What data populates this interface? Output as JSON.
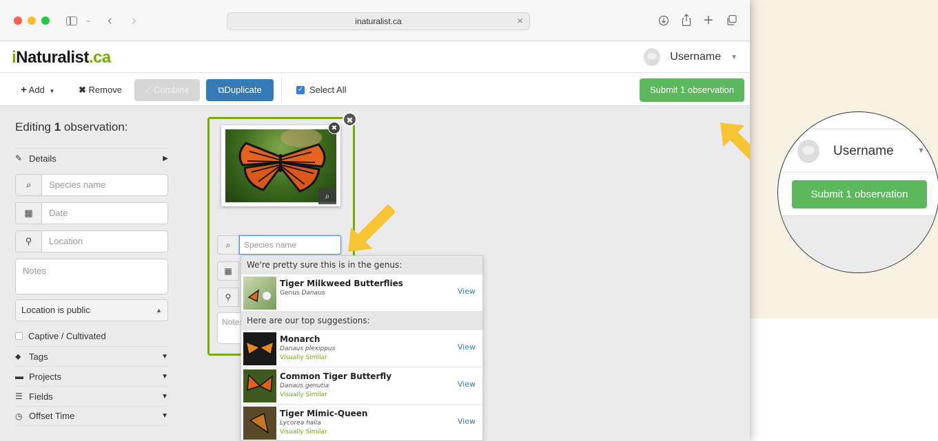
{
  "browser": {
    "url": "inaturalist.ca"
  },
  "header": {
    "logo_i": "i",
    "logo_main": "Naturalist",
    "logo_ca": ".ca",
    "username": "Username"
  },
  "toolbar": {
    "add_label": "Add",
    "remove_label": "Remove",
    "combine_label": "Combine",
    "duplicate_label": "Duplicate",
    "select_all_label": "Select All",
    "submit_label": "Submit 1 observation"
  },
  "left_panel": {
    "editing_prefix": "Editing ",
    "editing_count": "1",
    "editing_suffix": " observation:",
    "details_label": "Details",
    "species_placeholder": "Species name",
    "date_placeholder": "Date",
    "location_placeholder": "Location",
    "notes_placeholder": "Notes",
    "location_privacy": "Location is public",
    "captive_label": "Captive / Cultivated",
    "tags_label": "Tags",
    "projects_label": "Projects",
    "fields_label": "Fields",
    "offset_time_label": "Offset Time"
  },
  "card": {
    "species_placeholder": "Species name",
    "notes_placeholder": "Notes"
  },
  "autocomplete": {
    "genus_header": "We're pretty sure this is in the genus:",
    "top_header": "Here are our top suggestions:",
    "view_label": "View",
    "genus_item": {
      "title": "Tiger Milkweed Butterflies",
      "rank": "Genus",
      "scientific": "Danaus"
    },
    "suggestions": [
      {
        "title": "Monarch",
        "scientific": "Danaus plexippus",
        "tag": "Visually Similar"
      },
      {
        "title": "Common Tiger Butterfly",
        "scientific": "Danaus genutia",
        "tag": "Visually Similar"
      },
      {
        "title": "Tiger Mimic-Queen",
        "scientific": "Lycorea halia",
        "tag": "Visually Similar"
      }
    ]
  },
  "magnifier": {
    "username": "Username",
    "submit_label": "Submit 1 observation"
  },
  "colors": {
    "brand_green": "#74ac00",
    "submit_green": "#5cb85c",
    "duplicate_blue": "#337ab7",
    "arrow_yellow": "#f7c434"
  }
}
